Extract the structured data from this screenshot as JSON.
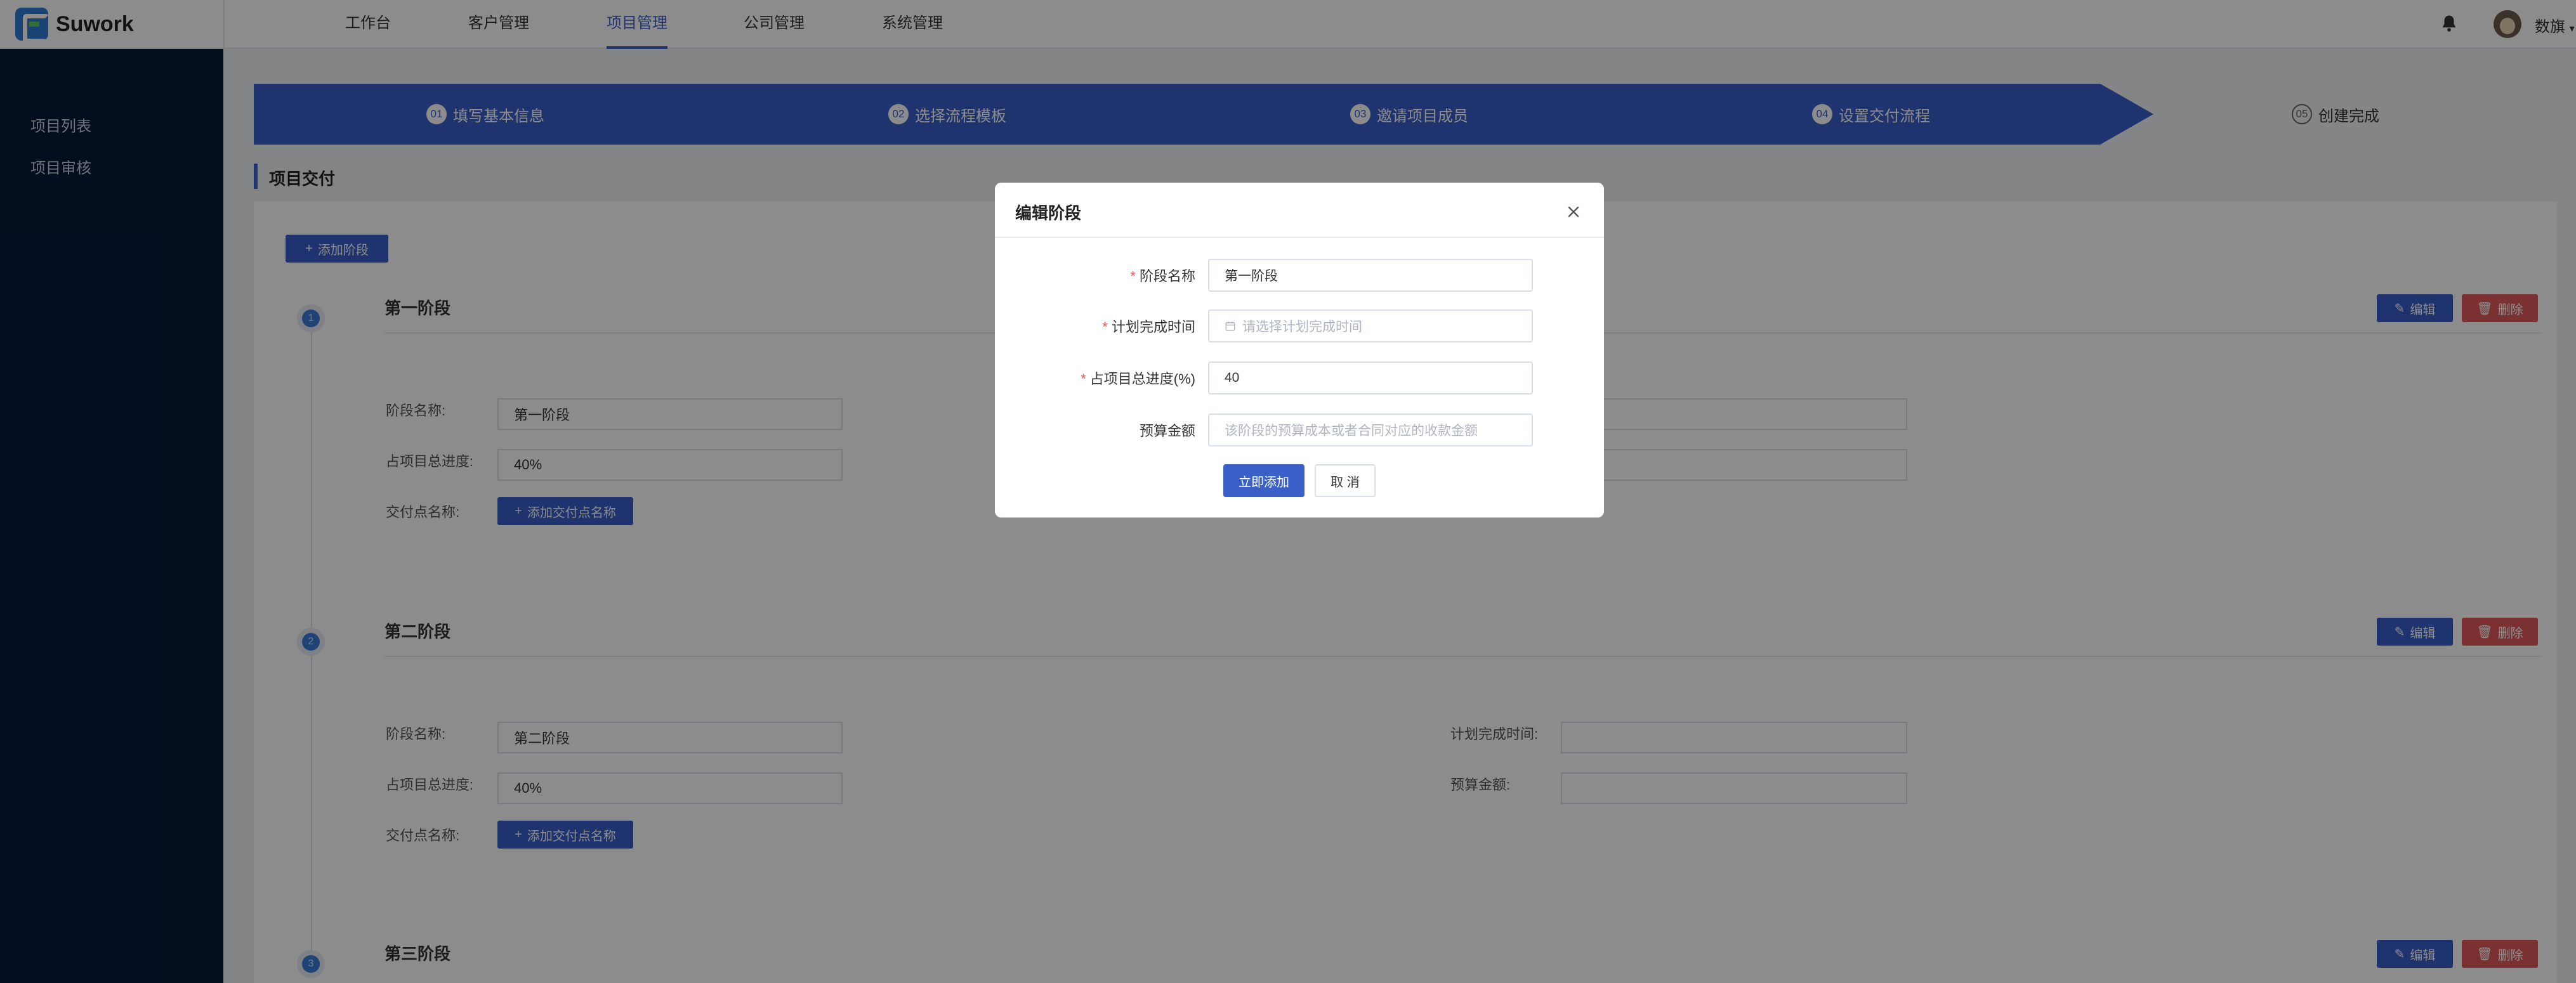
{
  "app": {
    "logo_text": "Suwork"
  },
  "nav": {
    "items": [
      {
        "label": "工作台"
      },
      {
        "label": "客户管理"
      },
      {
        "label": "项目管理"
      },
      {
        "label": "公司管理"
      },
      {
        "label": "系统管理"
      }
    ],
    "active": "项目管理",
    "user_name": "数旗"
  },
  "sidebar": {
    "items": [
      {
        "label": "项目列表"
      },
      {
        "label": "项目审核"
      }
    ]
  },
  "steps": [
    {
      "num": "01",
      "label": "填写基本信息"
    },
    {
      "num": "02",
      "label": "选择流程模板"
    },
    {
      "num": "03",
      "label": "邀请项目成员"
    },
    {
      "num": "04",
      "label": "设置交付流程"
    },
    {
      "num": "05",
      "label": "创建完成"
    }
  ],
  "section": {
    "title": "项目交付",
    "add_stage_label": "添加阶段"
  },
  "stages": [
    {
      "num": "1",
      "title": "第一阶段",
      "name_label": "阶段名称:",
      "name_value": "第一阶段",
      "progress_label": "占项目总进度:",
      "progress_value": "40%",
      "delivery_label": "交付点名称:",
      "add_delivery_label": "添加交付点名称",
      "edit_label": "编辑",
      "delete_label": "删除"
    },
    {
      "num": "2",
      "title": "第二阶段",
      "name_label": "阶段名称:",
      "name_value": "第二阶段",
      "progress_label": "占项目总进度:",
      "progress_value": "40%",
      "delivery_label": "交付点名称:",
      "add_delivery_label": "添加交付点名称",
      "plan_time_label": "计划完成时间:",
      "budget_label": "预算金额:",
      "edit_label": "编辑",
      "delete_label": "删除"
    },
    {
      "num": "3",
      "title": "第三阶段",
      "edit_label": "编辑",
      "delete_label": "删除"
    }
  ],
  "modal": {
    "title": "编辑阶段",
    "fields": [
      {
        "label": "阶段名称",
        "required": "*",
        "value": "第一阶段",
        "placeholder": ""
      },
      {
        "label": "计划完成时间",
        "required": "*",
        "value": "",
        "placeholder": "请选择计划完成时间"
      },
      {
        "label": "占项目总进度(%)",
        "required": "*",
        "value": "40",
        "placeholder": ""
      },
      {
        "label": "预算金额",
        "required": "",
        "value": "",
        "placeholder": "该阶段的预算成本或者合同对应的收款金额"
      }
    ],
    "submit_label": "立即添加",
    "cancel_label": "取 消"
  },
  "colors": {
    "primary": "#3a5fc8",
    "danger": "#e05a5a",
    "sidebar": "#081a3a"
  },
  "icons": [
    "bell-icon",
    "avatar",
    "close-icon",
    "calendar-icon",
    "plus-icon",
    "edit-icon",
    "trash-icon"
  ]
}
